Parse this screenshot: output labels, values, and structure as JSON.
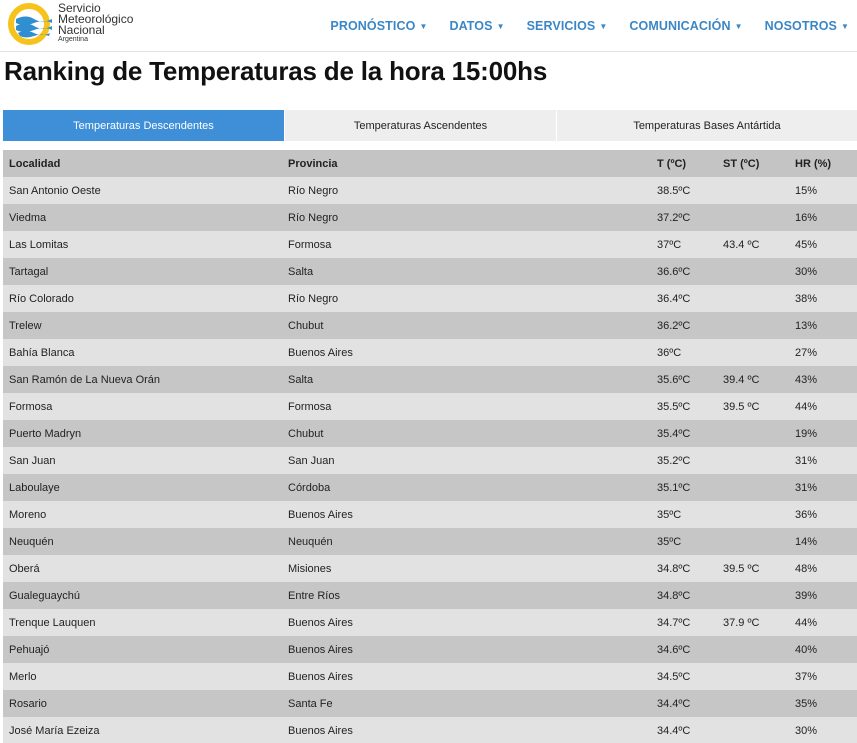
{
  "logo": {
    "line1": "Servicio",
    "line2": "Meteorológico",
    "line3": "Nacional",
    "line4": "Argentina"
  },
  "nav": [
    {
      "label": "PRONÓSTICO"
    },
    {
      "label": "DATOS"
    },
    {
      "label": "SERVICIOS"
    },
    {
      "label": "COMUNICACIÓN"
    },
    {
      "label": "NOSOTROS"
    }
  ],
  "title": "Ranking de Temperaturas de la hora 15:00hs",
  "tabs": [
    {
      "label": "Temperaturas Descendentes",
      "active": true
    },
    {
      "label": "Temperaturas Ascendentes",
      "active": false
    },
    {
      "label": "Temperaturas Bases Antártida",
      "active": false
    }
  ],
  "table": {
    "headers": [
      "Localidad",
      "Provincia",
      "T (ºC)",
      "ST (ºC)",
      "HR (%)"
    ],
    "rows": [
      [
        "San Antonio Oeste",
        "Río Negro",
        "38.5ºC",
        "",
        "15%"
      ],
      [
        "Viedma",
        "Río Negro",
        "37.2ºC",
        "",
        "16%"
      ],
      [
        "Las Lomitas",
        "Formosa",
        "37ºC",
        "43.4 ºC",
        "45%"
      ],
      [
        "Tartagal",
        "Salta",
        "36.6ºC",
        "",
        "30%"
      ],
      [
        "Río Colorado",
        "Río Negro",
        "36.4ºC",
        "",
        "38%"
      ],
      [
        "Trelew",
        "Chubut",
        "36.2ºC",
        "",
        "13%"
      ],
      [
        "Bahía Blanca",
        "Buenos Aires",
        "36ºC",
        "",
        "27%"
      ],
      [
        "San Ramón de La Nueva Orán",
        "Salta",
        "35.6ºC",
        "39.4 ºC",
        "43%"
      ],
      [
        "Formosa",
        "Formosa",
        "35.5ºC",
        "39.5 ºC",
        "44%"
      ],
      [
        "Puerto Madryn",
        "Chubut",
        "35.4ºC",
        "",
        "19%"
      ],
      [
        "San Juan",
        "San Juan",
        "35.2ºC",
        "",
        "31%"
      ],
      [
        "Laboulaye",
        "Córdoba",
        "35.1ºC",
        "",
        "31%"
      ],
      [
        "Moreno",
        "Buenos Aires",
        "35ºC",
        "",
        "36%"
      ],
      [
        "Neuquén",
        "Neuquén",
        "35ºC",
        "",
        "14%"
      ],
      [
        "Oberá",
        "Misiones",
        "34.8ºC",
        "39.5 ºC",
        "48%"
      ],
      [
        "Gualeguaychú",
        "Entre Ríos",
        "34.8ºC",
        "",
        "39%"
      ],
      [
        "Trenque Lauquen",
        "Buenos Aires",
        "34.7ºC",
        "37.9 ºC",
        "44%"
      ],
      [
        "Pehuajó",
        "Buenos Aires",
        "34.6ºC",
        "",
        "40%"
      ],
      [
        "Merlo",
        "Buenos Aires",
        "34.5ºC",
        "",
        "37%"
      ],
      [
        "Rosario",
        "Santa Fe",
        "34.4ºC",
        "",
        "35%"
      ],
      [
        "José María Ezeiza",
        "Buenos Aires",
        "34.4ºC",
        "",
        "30%"
      ]
    ]
  },
  "colors": {
    "accent": "#3f8fd8",
    "nav": "#3a87c7",
    "logo_yellow": "#f6c31c",
    "logo_blue": "#2f8fd0"
  }
}
